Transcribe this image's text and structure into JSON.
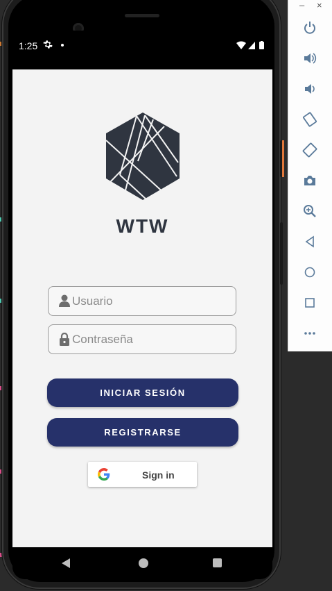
{
  "status_bar": {
    "time": "1:25",
    "settings_icon": "gear-icon",
    "notification_dot": "dot-icon",
    "wifi_icon": "wifi-icon",
    "signal_icon": "signal-icon",
    "battery_icon": "battery-icon"
  },
  "app": {
    "logo_icon": "hexagon-logo-icon",
    "title": "WTW",
    "username": {
      "placeholder": "Usuario",
      "value": "",
      "icon": "person-icon"
    },
    "password": {
      "placeholder": "Contraseña",
      "value": "",
      "icon": "lock-icon"
    },
    "login_button": "INICIAR SESIÓN",
    "register_button": "REGISTRARSE",
    "google_button": {
      "label": "Sign in",
      "icon": "google-icon"
    }
  },
  "nav_bar": {
    "back_icon": "back-icon",
    "home_icon": "home-icon",
    "recents_icon": "recents-icon"
  },
  "emulator_toolbar": {
    "minimize_label": "–",
    "close_label": "×",
    "tools": [
      "power-icon",
      "volume-up-icon",
      "volume-down-icon",
      "rotate-left-icon",
      "rotate-right-icon",
      "camera-icon",
      "zoom-icon",
      "back-icon",
      "home-icon",
      "overview-icon",
      "more-icon"
    ]
  },
  "colors": {
    "primary_button": "#26316a",
    "app_background": "#f3f3f3",
    "logo": "#2f3540",
    "emulator_accent": "#e0773a"
  }
}
